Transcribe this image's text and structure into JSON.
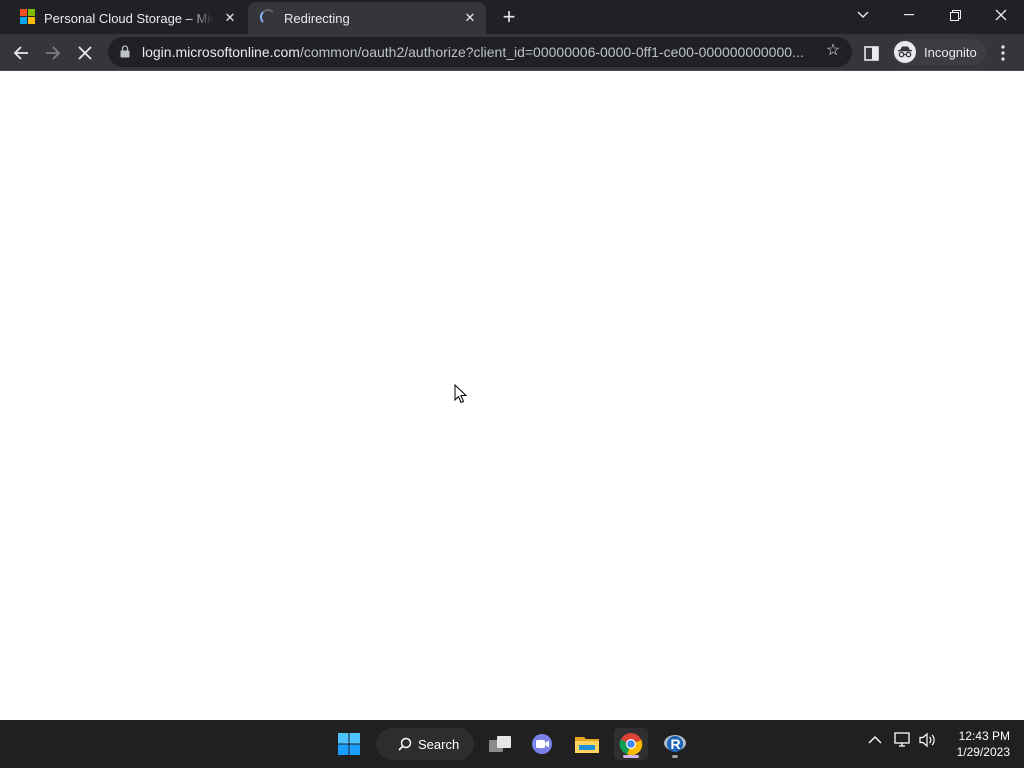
{
  "browser": {
    "tabs": [
      {
        "title": "Personal Cloud Storage – Microsoft OneDrive",
        "state": "inactive",
        "favicon": "microsoft-logo-icon"
      },
      {
        "title": "Redirecting",
        "state": "active",
        "favicon": "loading-spinner-icon"
      }
    ],
    "address": {
      "host": "login.microsoftonline.com",
      "path": "/common/oauth2/authorize?client_id=00000006-0000-0ff1-ce00-000000000000..."
    },
    "profile_label": "Incognito"
  },
  "taskbar": {
    "search_label": "Search",
    "time": "12:43 PM",
    "date": "1/29/2023",
    "icons": [
      "windows-start-icon",
      "search-icon",
      "task-view-icon",
      "teams-chat-icon",
      "file-explorer-icon",
      "chrome-icon",
      "r-app-icon"
    ]
  },
  "colors": {
    "tabstrip": "#202124",
    "toolbar": "#35363a",
    "page_background": "#ffffff",
    "taskbar": "#202020"
  }
}
